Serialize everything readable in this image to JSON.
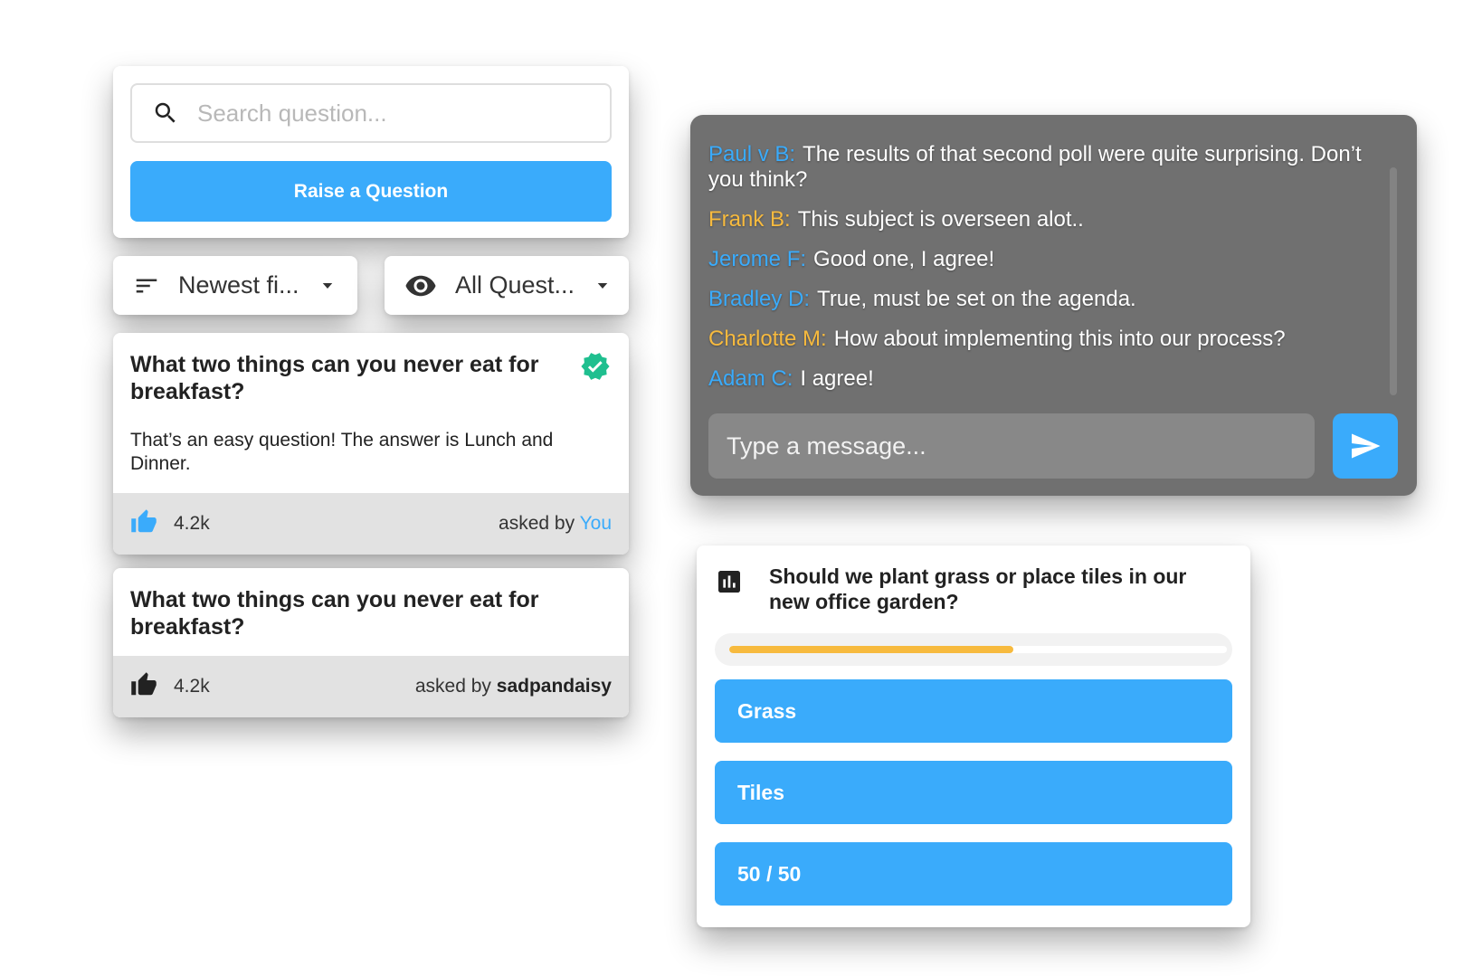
{
  "search": {
    "placeholder": "Search question...",
    "raise_label": "Raise a Question"
  },
  "filters": {
    "sort_label": "Newest fi...",
    "view_label": "All Quest..."
  },
  "questions": [
    {
      "title": "What two things can you never eat for breakfast?",
      "answer": "That’s an easy question! The answer is Lunch and Dinner.",
      "verified": true,
      "likes": "4.2k",
      "asked_prefix": "asked by",
      "asked_by": "You",
      "like_color": "#3aabfb"
    },
    {
      "title": "What two things can you never eat for breakfast?",
      "likes": "4.2k",
      "asked_prefix": "asked by",
      "asked_by": "sadpandaisy",
      "like_color": "#222222"
    }
  ],
  "chat": {
    "messages": [
      {
        "name": "Paul v B:",
        "text": "The results of that second poll were quite surprising. Don’t you think?",
        "color": "blue"
      },
      {
        "name": "Frank B:",
        "text": "This subject is overseen alot..",
        "color": "orange"
      },
      {
        "name": "Jerome F:",
        "text": "Good one, I agree!",
        "color": "blue"
      },
      {
        "name": "Bradley D:",
        "text": "True, must be set on the agenda.",
        "color": "blue"
      },
      {
        "name": "Charlotte M:",
        "text": "How about implementing this into our process?",
        "color": "orange"
      },
      {
        "name": "Adam C:",
        "text": "I agree!",
        "color": "blue"
      }
    ],
    "input_placeholder": "Type a message..."
  },
  "poll": {
    "question": "Should we plant grass or place tiles in our new office garden?",
    "progress": 0.57,
    "options": [
      "Grass",
      "Tiles",
      "50 / 50"
    ]
  },
  "colors": {
    "accent": "#3aabfb",
    "orange": "#f7ba3e",
    "verified": "#1fbf8f",
    "chat_bg": "#707070"
  }
}
